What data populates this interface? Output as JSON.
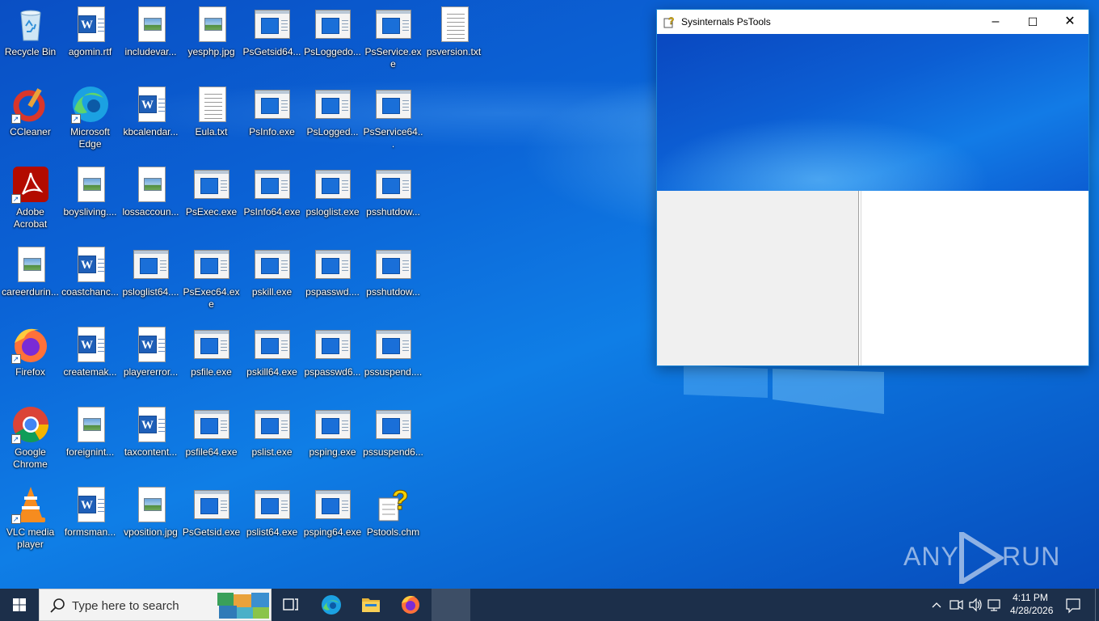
{
  "desktop": {
    "icons": [
      {
        "label": "Recycle Bin",
        "type": "recycle"
      },
      {
        "label": "agomin.rtf",
        "type": "word"
      },
      {
        "label": "includevar...",
        "type": "image"
      },
      {
        "label": "yesphp.jpg",
        "type": "image"
      },
      {
        "label": "PsGetsid64...",
        "type": "exe"
      },
      {
        "label": "PsLoggedo...",
        "type": "exe"
      },
      {
        "label": "PsService.exe",
        "type": "exe"
      },
      {
        "label": "psversion.txt",
        "type": "text"
      },
      {
        "label": "CCleaner",
        "type": "ccleaner"
      },
      {
        "label": "Microsoft Edge",
        "type": "edge"
      },
      {
        "label": "kbcalendar...",
        "type": "word"
      },
      {
        "label": "Eula.txt",
        "type": "text"
      },
      {
        "label": "PsInfo.exe",
        "type": "exe"
      },
      {
        "label": "PsLogged...",
        "type": "exe"
      },
      {
        "label": "PsService64...",
        "type": "exe"
      },
      {
        "label": "Adobe Acrobat",
        "type": "acrobat"
      },
      {
        "label": "boysliving....",
        "type": "image"
      },
      {
        "label": "lossaccoun...",
        "type": "image"
      },
      {
        "label": "PsExec.exe",
        "type": "exe"
      },
      {
        "label": "PsInfo64.exe",
        "type": "exe"
      },
      {
        "label": "psloglist.exe",
        "type": "exe"
      },
      {
        "label": "psshutdow...",
        "type": "exe"
      },
      {
        "label": "careerdurin...",
        "type": "image"
      },
      {
        "label": "coastchanc...",
        "type": "word"
      },
      {
        "label": "psloglist64....",
        "type": "exe"
      },
      {
        "label": "PsExec64.exe",
        "type": "exe"
      },
      {
        "label": "pskill.exe",
        "type": "exe"
      },
      {
        "label": "pspasswd....",
        "type": "exe"
      },
      {
        "label": "psshutdow...",
        "type": "exe"
      },
      {
        "label": "Firefox",
        "type": "firefox"
      },
      {
        "label": "createmak...",
        "type": "word"
      },
      {
        "label": "playererror...",
        "type": "word"
      },
      {
        "label": "psfile.exe",
        "type": "exe"
      },
      {
        "label": "pskill64.exe",
        "type": "exe"
      },
      {
        "label": "pspasswd6...",
        "type": "exe"
      },
      {
        "label": "pssuspend....",
        "type": "exe"
      },
      {
        "label": "Google Chrome",
        "type": "chrome"
      },
      {
        "label": "foreignint...",
        "type": "image"
      },
      {
        "label": "taxcontent...",
        "type": "word"
      },
      {
        "label": "psfile64.exe",
        "type": "exe"
      },
      {
        "label": "pslist.exe",
        "type": "exe"
      },
      {
        "label": "psping.exe",
        "type": "exe"
      },
      {
        "label": "pssuspend6...",
        "type": "exe"
      },
      {
        "label": "VLC media player",
        "type": "vlc"
      },
      {
        "label": "formsman...",
        "type": "word"
      },
      {
        "label": "vposition.jpg",
        "type": "image"
      },
      {
        "label": "PsGetsid.exe",
        "type": "exe"
      },
      {
        "label": "pslist64.exe",
        "type": "exe"
      },
      {
        "label": "psping64.exe",
        "type": "exe"
      },
      {
        "label": "Pstools.chm",
        "type": "chm"
      }
    ]
  },
  "window": {
    "title": "Sysinternals PsTools",
    "minimize": "–",
    "maximize": "☐",
    "close": "✕"
  },
  "watermark": {
    "left": "ANY",
    "right": "RUN"
  },
  "taskbar": {
    "search_placeholder": "Type here to search",
    "time": "4:11 PM",
    "date": "4/28/2026"
  }
}
